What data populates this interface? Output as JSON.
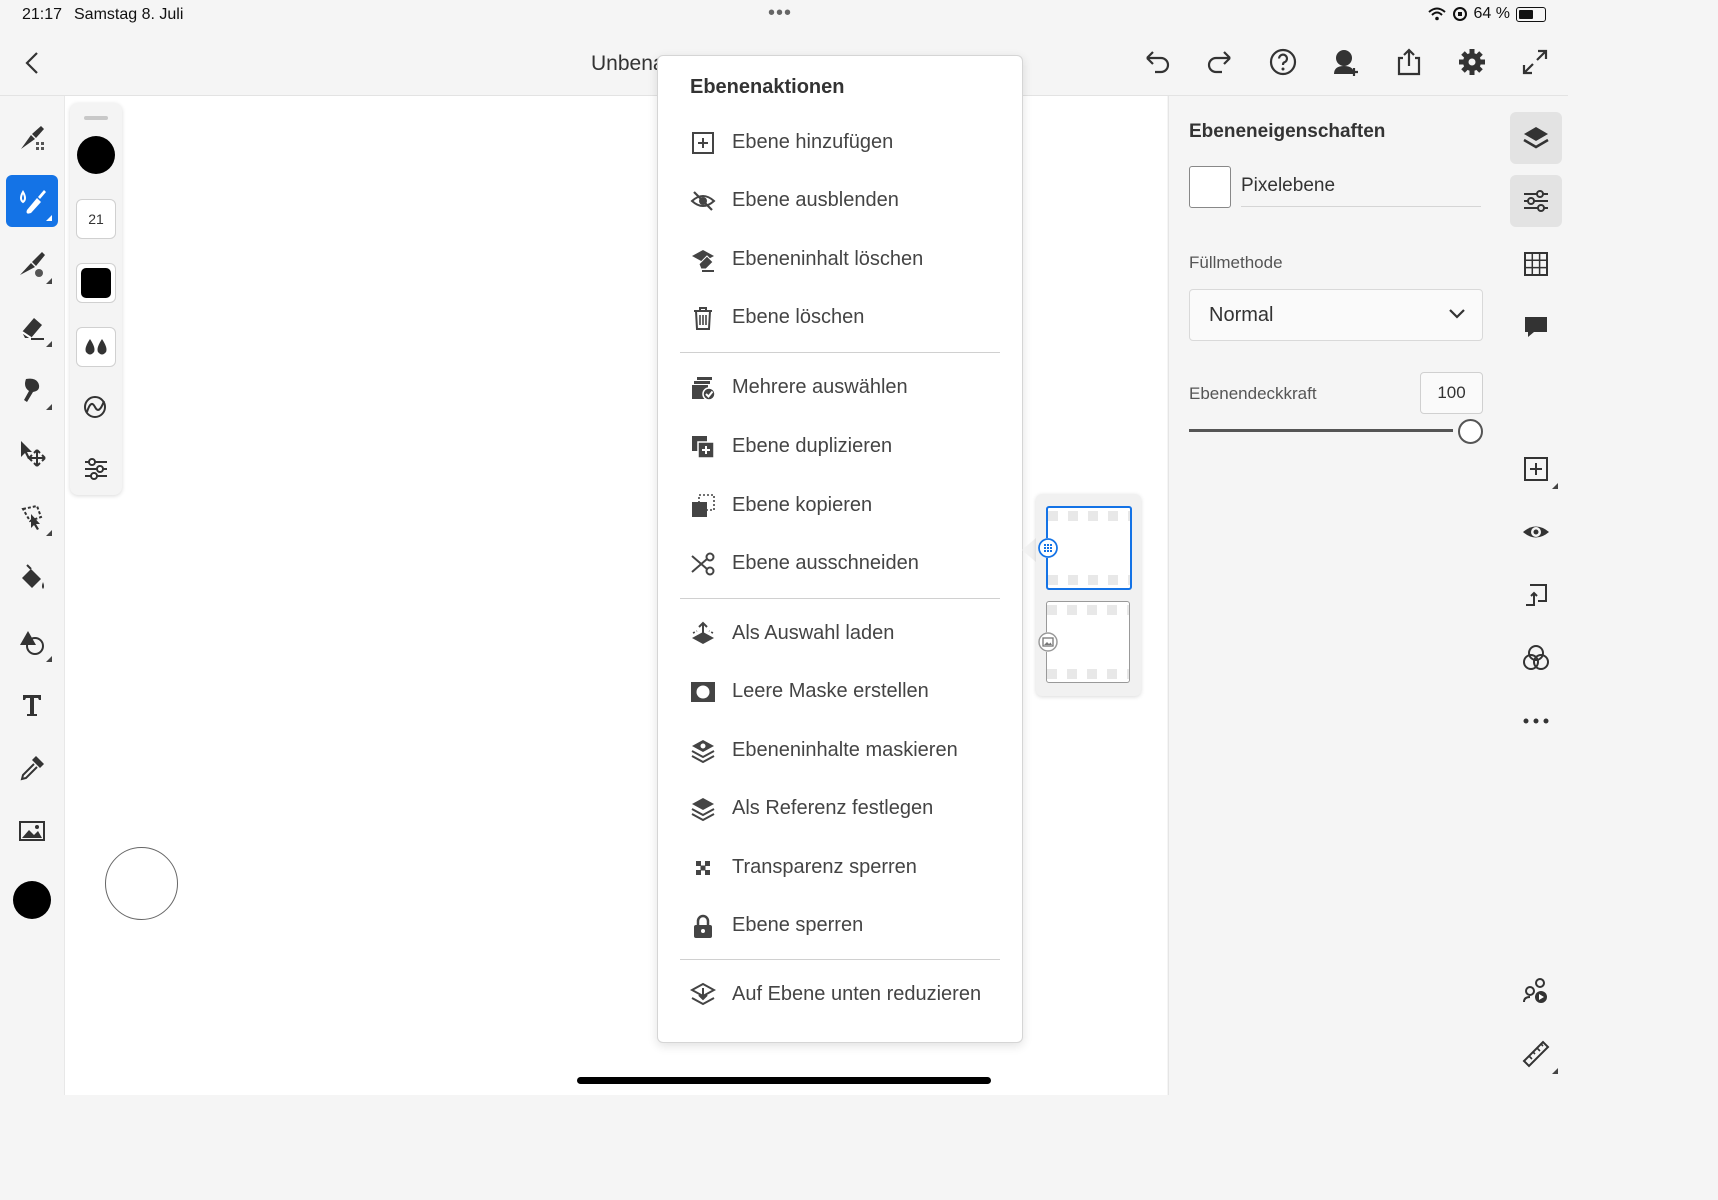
{
  "status_bar": {
    "time": "21:17",
    "date": "Samstag 8. Juli",
    "battery": "64 %",
    "battery_level": 0.64
  },
  "toolbar": {
    "document_title": "Unbena",
    "icons": [
      "back-chevron-icon",
      "undo-icon",
      "redo-icon",
      "help-icon",
      "invite-user-icon",
      "share-icon",
      "settings-gear-icon",
      "fullscreen-icon"
    ]
  },
  "brush_panel": {
    "size_value": "21"
  },
  "layer_actions_menu": {
    "title": "Ebenenaktionen",
    "groups": [
      [
        {
          "label": "Ebene hinzufügen",
          "icon": "add-layer-icon"
        },
        {
          "label": "Ebene ausblenden",
          "icon": "hide-eye-icon"
        },
        {
          "label": "Ebeneninhalt löschen",
          "icon": "clear-content-icon"
        },
        {
          "label": "Ebene löschen",
          "icon": "trash-icon"
        }
      ],
      [
        {
          "label": "Mehrere auswählen",
          "icon": "multi-select-icon"
        },
        {
          "label": "Ebene duplizieren",
          "icon": "duplicate-icon"
        },
        {
          "label": "Ebene kopieren",
          "icon": "copy-icon"
        },
        {
          "label": "Ebene ausschneiden",
          "icon": "scissors-icon"
        }
      ],
      [
        {
          "label": "Als Auswahl laden",
          "icon": "load-selection-icon"
        },
        {
          "label": "Leere Maske erstellen",
          "icon": "mask-icon"
        },
        {
          "label": "Ebeneninhalte maskieren",
          "icon": "mask-content-icon"
        },
        {
          "label": "Als Referenz festlegen",
          "icon": "reference-icon"
        },
        {
          "label": "Transparenz sperren",
          "icon": "lock-transparency-icon"
        },
        {
          "label": "Ebene sperren",
          "icon": "lock-icon"
        }
      ],
      [
        {
          "label": "Auf Ebene unten reduzieren",
          "icon": "merge-down-icon"
        }
      ]
    ]
  },
  "properties_panel": {
    "title": "Ebeneneigenschaften",
    "layer_name": "Pixelebene",
    "blend_label": "Füllmethode",
    "blend_value": "Normal",
    "opacity_label": "Ebenendeckkraft",
    "opacity_value": "100"
  },
  "colors": {
    "accent": "#1473e6",
    "foreground_color": "#000000"
  }
}
